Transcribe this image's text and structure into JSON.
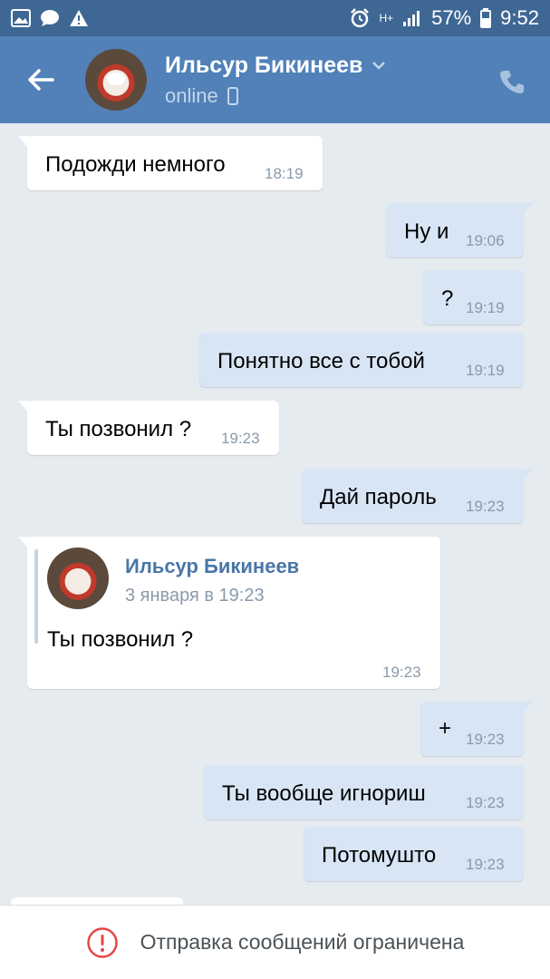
{
  "status_bar": {
    "battery": "57%",
    "time": "9:52",
    "network": "H+"
  },
  "header": {
    "name": "Ильсур Бикинеев",
    "status": "online"
  },
  "messages": [
    {
      "dir": "in",
      "text": "Подожди немного",
      "time": "18:19"
    },
    {
      "dir": "out",
      "text": "Ну и",
      "time": "19:06"
    },
    {
      "dir": "out",
      "text": "?",
      "time": "19:19"
    },
    {
      "dir": "out",
      "text": "Понятно все с тобой",
      "time": "19:19"
    },
    {
      "dir": "in",
      "text": "Ты позвонил ?",
      "time": "19:23"
    },
    {
      "dir": "out",
      "text": "Дай пароль",
      "time": "19:23"
    },
    {
      "dir": "in",
      "forward": {
        "name": "Ильсур Бикинеев",
        "date": "3 января в 19:23",
        "text": "Ты позвонил ?"
      },
      "time": "19:23"
    },
    {
      "dir": "out",
      "text": "+",
      "time": "19:23"
    },
    {
      "dir": "out",
      "text": "Ты вообще игнориш",
      "time": "19:23"
    },
    {
      "dir": "out",
      "text": "Потомушто",
      "time": "19:23"
    }
  ],
  "bottom": {
    "notice": "Отправка сообщений ограничена"
  },
  "colors": {
    "header": "#5181b8",
    "status_bar": "#3e6794",
    "background": "#e6ebf0",
    "outgoing": "#d7e5f5",
    "incoming": "#ffffff",
    "alert": "#e64646"
  }
}
